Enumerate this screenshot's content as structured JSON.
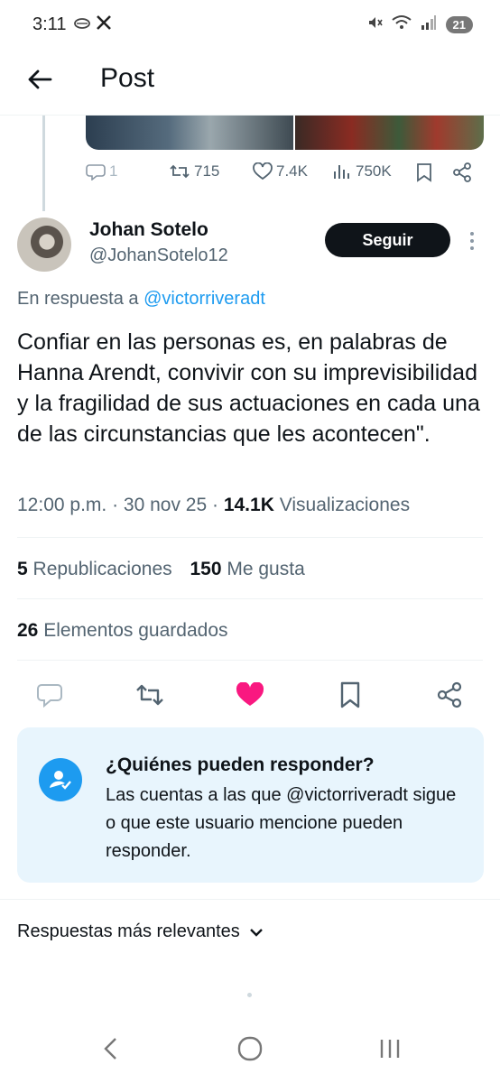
{
  "status_bar": {
    "time": "3:11",
    "left_icons": [
      "cloud-icon",
      "x-logo-icon"
    ],
    "right_icons": [
      "mute-icon",
      "wifi-icon",
      "signal-icon"
    ],
    "battery": "21"
  },
  "header": {
    "title": "Post",
    "back_icon": "arrow-left-icon"
  },
  "parent_tweet": {
    "replies": "1",
    "reposts": "715",
    "likes": "7.4K",
    "views": "750K"
  },
  "author": {
    "name": "Johan Sotelo",
    "handle": "@JohanSotelo12",
    "follow_label": "Seguir"
  },
  "reply_to": {
    "prefix": "En respuesta a",
    "mention": "@victorriveradt"
  },
  "tweet": {
    "text": "Confiar en las personas es, en palabras de Hanna Arendt, convivir con su imprevisibilidad y la fragilidad de sus actuaciones en cada una de las circunstancias que les acontecen\".",
    "time": "12:00 p.m.",
    "date": "30 nov 25",
    "views_count": "14.1K",
    "views_label": "Visualizaciones"
  },
  "stats": {
    "reposts_count": "5",
    "reposts_label": "Republicaciones",
    "likes_count": "150",
    "likes_label": "Me gusta",
    "saved_count": "26",
    "saved_label": "Elementos guardados"
  },
  "colors": {
    "accent": "#1d9bf0",
    "like": "#f91880",
    "muted": "#536471",
    "card_bg": "#e8f5fd"
  },
  "who_can_reply": {
    "title": "¿Quiénes pueden responder?",
    "description": "Las cuentas a las que @victorriveradt sigue o que este usuario mencione pueden responder."
  },
  "sort": {
    "label": "Respuestas más relevantes"
  }
}
